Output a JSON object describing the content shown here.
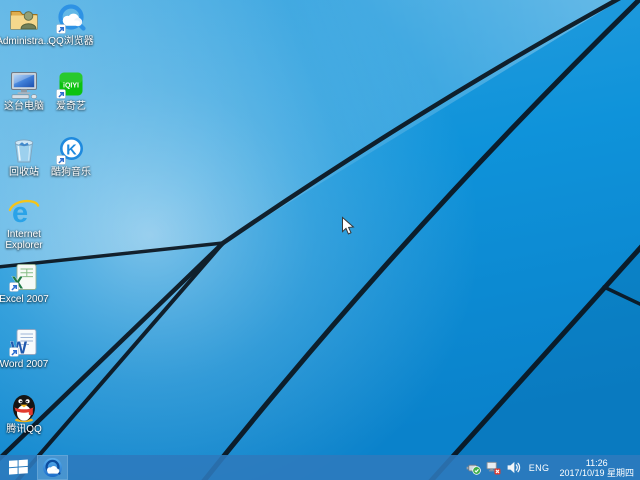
{
  "wallpaper": {
    "description": "Windows 8.1 style azure wallpaper with dark diagonal light-trail lines",
    "base_color": "#0f93d8",
    "line_color": "#0b151f"
  },
  "desktop": {
    "icons": [
      {
        "name": "administrator",
        "label": "Administra...",
        "has_shortcut_arrow": false
      },
      {
        "name": "qq-browser",
        "label": "QQ浏览器",
        "has_shortcut_arrow": true
      },
      {
        "name": "this-pc",
        "label": "这台电脑",
        "has_shortcut_arrow": false
      },
      {
        "name": "iqiyi",
        "label": "爱奇艺",
        "has_shortcut_arrow": true
      },
      {
        "name": "recycle-bin",
        "label": "回收站",
        "has_shortcut_arrow": false
      },
      {
        "name": "kugou-music",
        "label": "酷狗音乐",
        "has_shortcut_arrow": true
      },
      {
        "name": "internet-explorer",
        "label": "Internet Explorer",
        "has_shortcut_arrow": false
      },
      {
        "name": "excel-2007",
        "label": "Excel 2007",
        "has_shortcut_arrow": true
      },
      {
        "name": "word-2007",
        "label": "Word 2007",
        "has_shortcut_arrow": true
      },
      {
        "name": "tencent-qq",
        "label": "腾讯QQ",
        "has_shortcut_arrow": true
      }
    ]
  },
  "icon_glyphs": {
    "iqiyi": "iQIYI",
    "kugou": "K",
    "ie": "e",
    "excel": "X",
    "word": "W"
  },
  "taskbar": {
    "color": "#3382c3",
    "start_button_icon": "windows-logo-icon",
    "pinned": [
      {
        "name": "qq-browser",
        "icon": "qq-browser-icon"
      }
    ],
    "tray": {
      "icons": [
        "usb-safely-remove-icon",
        "network-disconnected-icon",
        "volume-icon"
      ],
      "language": "ENG",
      "time": "11:26",
      "date": "2017/10/19 星期四"
    }
  }
}
